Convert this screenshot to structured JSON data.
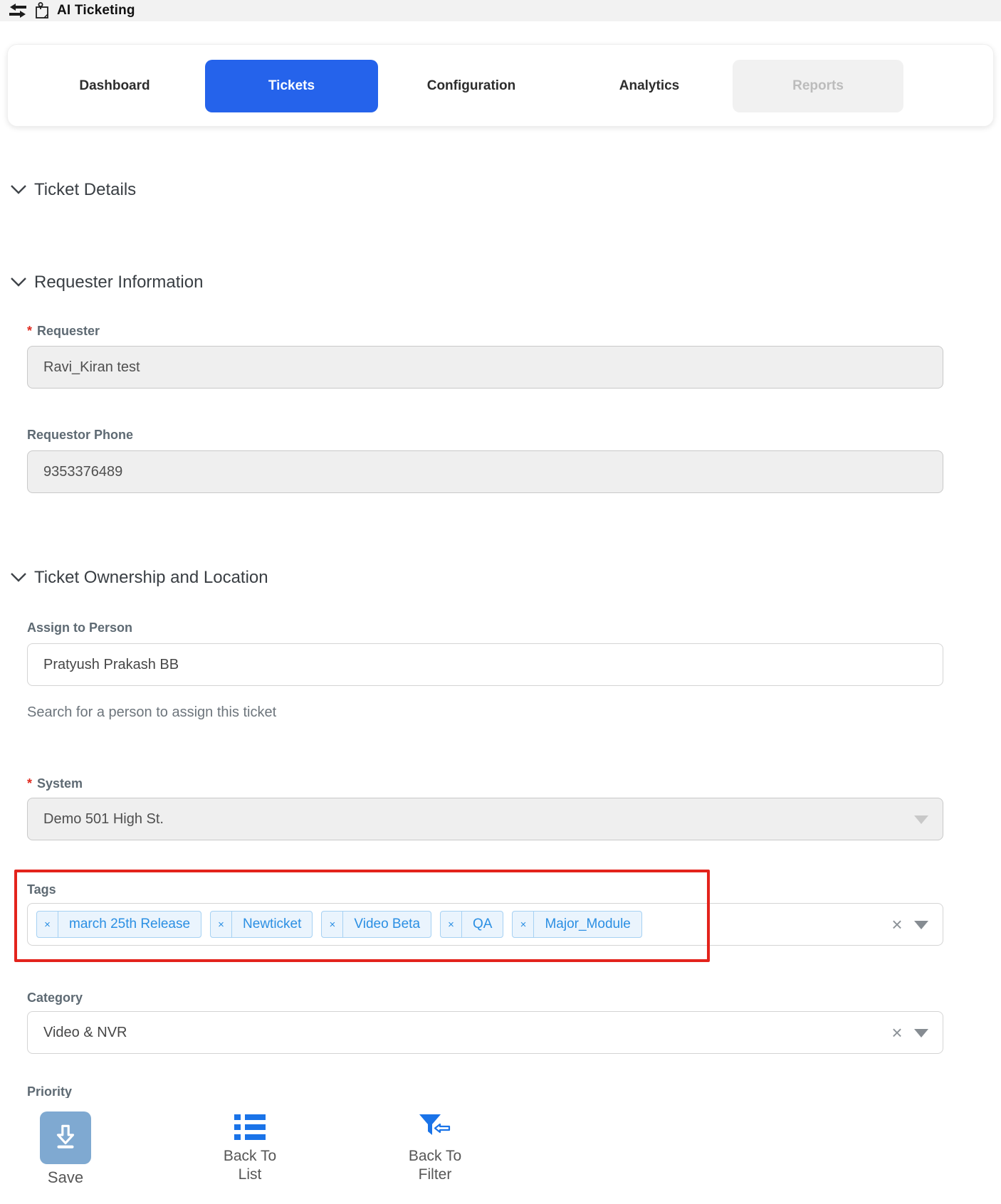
{
  "topbar": {
    "title": "AI Ticketing"
  },
  "tabs": [
    {
      "label": "Dashboard",
      "state": "normal"
    },
    {
      "label": "Tickets",
      "state": "active"
    },
    {
      "label": "Configuration",
      "state": "normal"
    },
    {
      "label": "Analytics",
      "state": "normal"
    },
    {
      "label": "Reports",
      "state": "disabled"
    }
  ],
  "sections": {
    "ticket_details": "Ticket Details",
    "requester_information": "Requester Information",
    "ticket_ownership": "Ticket Ownership and Location"
  },
  "fields": {
    "requester": {
      "label": "Requester",
      "required": true,
      "value": "Ravi_Kiran test"
    },
    "requestor_phone": {
      "label": "Requestor Phone",
      "value": "9353376489"
    },
    "assign_to_person": {
      "label": "Assign to Person",
      "value": "Pratyush Prakash BB",
      "helper": "Search for a person to assign this ticket"
    },
    "system": {
      "label": "System",
      "required": true,
      "value": "Demo 501 High St."
    },
    "tags": {
      "label": "Tags",
      "values": [
        "march 25th Release",
        "Newticket",
        "Video Beta",
        "QA",
        "Major_Module"
      ]
    },
    "category": {
      "label": "Category",
      "value": "Video & NVR"
    },
    "priority": {
      "label": "Priority"
    }
  },
  "footer": {
    "save_label": "Save",
    "back_to_list": [
      "Back To",
      "List"
    ],
    "back_to_filter": [
      "Back To",
      "Filter"
    ]
  },
  "ui": {
    "required_marker": "*",
    "clear_icon": "×",
    "chip_remove_icon": "×"
  },
  "colors": {
    "accent": "#2563eb",
    "tag_text": "#2b8fe3",
    "tag_bg": "#eaf4fd",
    "tag_border": "#a6d1f3",
    "highlight_red": "#e3231c",
    "save_button_bg": "#7fa9d1",
    "icon_blue": "#1a73e8",
    "label_gray": "#5e6a73"
  }
}
